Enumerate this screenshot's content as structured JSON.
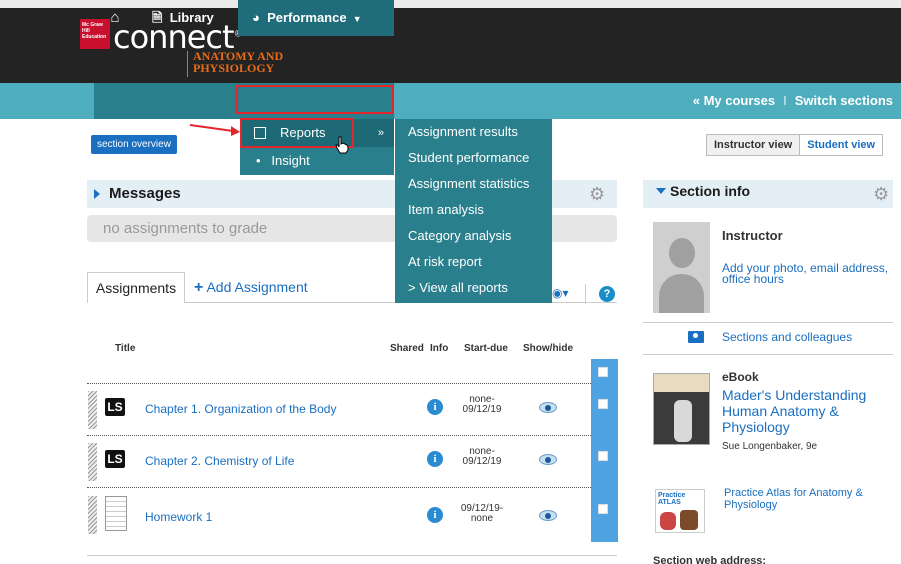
{
  "header": {
    "logo_box_text": "Mc Graw Hill Education",
    "logo_text": "connect",
    "subtitle_line1": "ANATOMY AND",
    "subtitle_line2": "PHYSIOLOGY"
  },
  "nav": {
    "home_icon": "home-icon",
    "library": "Library",
    "performance": "Performance",
    "my_courses": "« My courses",
    "separator": "I",
    "switch_sections": "Switch sections"
  },
  "performance_menu": {
    "reports": "Reports",
    "reports_arrow": "»",
    "insight": "Insight",
    "insight_bullet": "•"
  },
  "reports_submenu": [
    "Assignment results",
    "Student performance",
    "Assignment statistics",
    "Item analysis",
    "Category analysis",
    "At risk report",
    "> View all reports"
  ],
  "section_overview": "section overview",
  "view_toggle": {
    "instructor": "Instructor view",
    "student": "Student view"
  },
  "messages": {
    "title": "Messages",
    "empty": "no assignments to grade"
  },
  "assignments": {
    "tab": "Assignments",
    "add_plus": "+",
    "add": "Add Assignment",
    "help": "?",
    "columns": {
      "title": "Title",
      "shared": "Shared",
      "info": "Info",
      "start_due": "Start-due",
      "show_hide": "Show/hide"
    },
    "rows": [
      {
        "badge": "LS",
        "title": "Chapter 1. Organization of the Body",
        "start": "none-",
        "due": "09/12/19"
      },
      {
        "badge": "LS",
        "title": "Chapter 2. Chemistry of Life",
        "start": "none-",
        "due": "09/12/19"
      },
      {
        "badge": "",
        "title": "Homework 1",
        "start": "09/12/19-",
        "due": "none"
      }
    ],
    "info_glyph": "i"
  },
  "section_info": {
    "title": "Section info",
    "instructor": "Instructor",
    "add_photo": "Add your photo, email address, office hours",
    "colleagues": "Sections and colleagues",
    "ebook_label": "eBook",
    "ebook_title": "Mader's Understanding Human Anatomy & Physiology",
    "ebook_author": "Sue Longenbaker, 9e",
    "atlas_link": "Practice Atlas for Anatomy & Physiology",
    "atlas_thumb_text": "Practice ATLAS",
    "web_address": "Section web address:"
  },
  "colors": {
    "nav": "#4eaebd",
    "nav_dark": "#2a7f8c",
    "link": "#1a6fc0",
    "highlight": "#e2262c",
    "brand_orange": "#e76b1a"
  }
}
